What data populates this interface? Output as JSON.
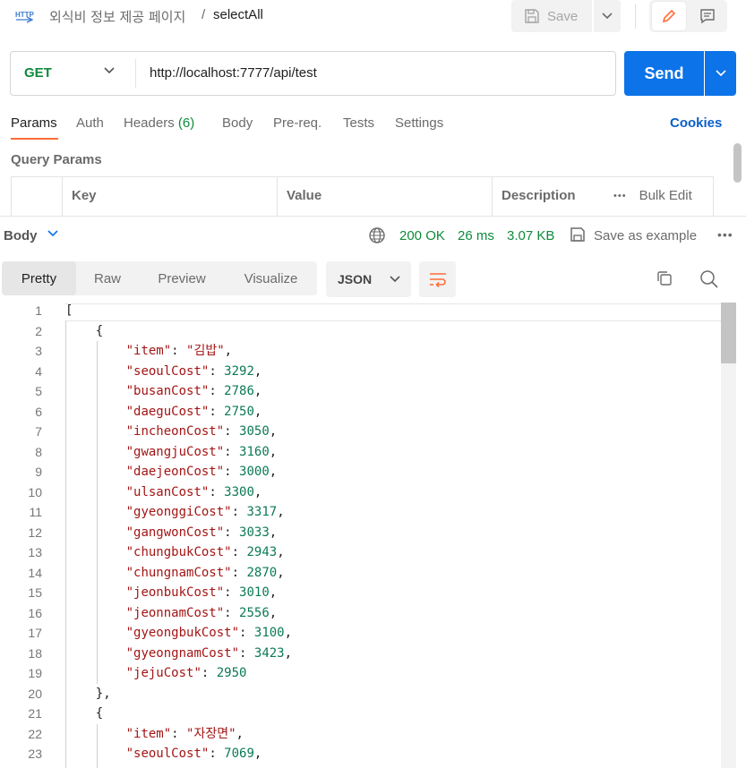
{
  "header": {
    "collection": "외식비 정보 제공 페이지",
    "separator": "/",
    "request_name": "selectAll",
    "save_label": "Save"
  },
  "request": {
    "method": "GET",
    "url": "http://localhost:7777/api/test",
    "send_label": "Send"
  },
  "tabs": {
    "params": "Params",
    "auth": "Auth",
    "headers": "Headers",
    "headers_count": "(6)",
    "body": "Body",
    "prereq": "Pre-req.",
    "tests": "Tests",
    "settings": "Settings",
    "cookies": "Cookies"
  },
  "query_params": {
    "title": "Query Params",
    "columns": [
      "Key",
      "Value",
      "Description"
    ],
    "more": "•••",
    "bulk_edit": "Bulk Edit"
  },
  "response": {
    "body_label": "Body",
    "status": "200 OK",
    "time": "26 ms",
    "size": "3.07 KB",
    "save_example": "Save as example",
    "more": "•••"
  },
  "view_tabs": [
    "Pretty",
    "Raw",
    "Preview",
    "Visualize"
  ],
  "format": "JSON",
  "code_lines": [
    {
      "n": "1",
      "indent": 0,
      "type": "plain",
      "text": "["
    },
    {
      "n": "2",
      "indent": 1,
      "type": "plain",
      "text": "{"
    },
    {
      "n": "3",
      "indent": 2,
      "type": "kv-str",
      "k": "\"item\"",
      "v": "\"김밥\"",
      "comma": true
    },
    {
      "n": "4",
      "indent": 2,
      "type": "kv-num",
      "k": "\"seoulCost\"",
      "v": "3292",
      "comma": true
    },
    {
      "n": "5",
      "indent": 2,
      "type": "kv-num",
      "k": "\"busanCost\"",
      "v": "2786",
      "comma": true
    },
    {
      "n": "6",
      "indent": 2,
      "type": "kv-num",
      "k": "\"daeguCost\"",
      "v": "2750",
      "comma": true
    },
    {
      "n": "7",
      "indent": 2,
      "type": "kv-num",
      "k": "\"incheonCost\"",
      "v": "3050",
      "comma": true
    },
    {
      "n": "8",
      "indent": 2,
      "type": "kv-num",
      "k": "\"gwangjuCost\"",
      "v": "3160",
      "comma": true
    },
    {
      "n": "9",
      "indent": 2,
      "type": "kv-num",
      "k": "\"daejeonCost\"",
      "v": "3000",
      "comma": true
    },
    {
      "n": "10",
      "indent": 2,
      "type": "kv-num",
      "k": "\"ulsanCost\"",
      "v": "3300",
      "comma": true
    },
    {
      "n": "11",
      "indent": 2,
      "type": "kv-num",
      "k": "\"gyeonggiCost\"",
      "v": "3317",
      "comma": true
    },
    {
      "n": "12",
      "indent": 2,
      "type": "kv-num",
      "k": "\"gangwonCost\"",
      "v": "3033",
      "comma": true
    },
    {
      "n": "13",
      "indent": 2,
      "type": "kv-num",
      "k": "\"chungbukCost\"",
      "v": "2943",
      "comma": true
    },
    {
      "n": "14",
      "indent": 2,
      "type": "kv-num",
      "k": "\"chungnamCost\"",
      "v": "2870",
      "comma": true
    },
    {
      "n": "15",
      "indent": 2,
      "type": "kv-num",
      "k": "\"jeonbukCost\"",
      "v": "3010",
      "comma": true
    },
    {
      "n": "16",
      "indent": 2,
      "type": "kv-num",
      "k": "\"jeonnamCost\"",
      "v": "2556",
      "comma": true
    },
    {
      "n": "17",
      "indent": 2,
      "type": "kv-num",
      "k": "\"gyeongbukCost\"",
      "v": "3100",
      "comma": true
    },
    {
      "n": "18",
      "indent": 2,
      "type": "kv-num",
      "k": "\"gyeongnamCost\"",
      "v": "3423",
      "comma": true
    },
    {
      "n": "19",
      "indent": 2,
      "type": "kv-num",
      "k": "\"jejuCost\"",
      "v": "2950",
      "comma": false
    },
    {
      "n": "20",
      "indent": 1,
      "type": "plain",
      "text": "},"
    },
    {
      "n": "21",
      "indent": 1,
      "type": "plain",
      "text": "{"
    },
    {
      "n": "22",
      "indent": 2,
      "type": "kv-str",
      "k": "\"item\"",
      "v": "\"자장면\"",
      "comma": true
    },
    {
      "n": "23",
      "indent": 2,
      "type": "kv-num",
      "k": "\"seoulCost\"",
      "v": "7069",
      "comma": true
    }
  ],
  "colors": {
    "accent": "#ff6c37",
    "send": "#0c73e8",
    "method_get": "#0f8a3c",
    "json_key": "#a31515",
    "json_number": "#0b7a55"
  },
  "icons": {
    "http": "http-icon",
    "save": "save-icon",
    "edit": "pencil-icon",
    "docs": "comment-icon",
    "globe": "globe-icon",
    "copy": "copy-icon",
    "search": "search-icon",
    "wrap": "wrap-lines-icon"
  }
}
